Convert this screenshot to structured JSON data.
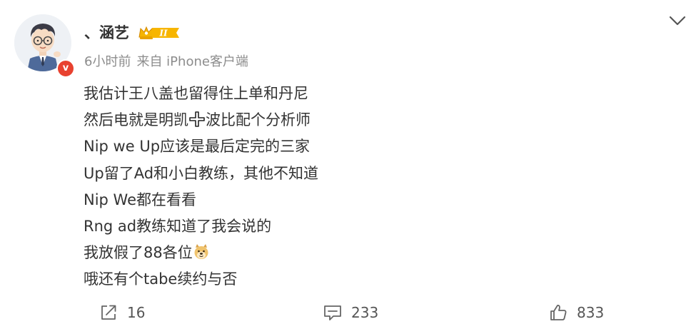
{
  "post": {
    "author": {
      "name": "、涵艺",
      "badge_label": "II"
    },
    "meta": {
      "time": "6小时前",
      "source": "来自 iPhone客户端"
    },
    "content": {
      "lines": [
        [
          "我估计王八盖也留得住上单和丹尼"
        ],
        [
          "然后电就是明凯",
          "",
          "波比配个分析师"
        ],
        [
          "Nip we Up应该是最后定完的三家"
        ],
        [
          "Up留了Ad和小白教练，其他不知道"
        ],
        [
          "Nip We都在看看"
        ],
        [
          "Rng ad教练知道了我会说的"
        ],
        [
          "我放假了88各位",
          ""
        ],
        [
          "哦还有个tabe续约与否"
        ]
      ]
    },
    "actions": {
      "share_count": "16",
      "comment_count": "233",
      "like_count": "833"
    },
    "icons": {
      "plus_emoji": "plus-emoji-icon",
      "doge_emoji": "doge-emoji-icon"
    },
    "colors": {
      "verified": "#e8412f",
      "badge_gold": "#f5b400",
      "text": "#333333",
      "meta": "#8c8c8c"
    }
  }
}
